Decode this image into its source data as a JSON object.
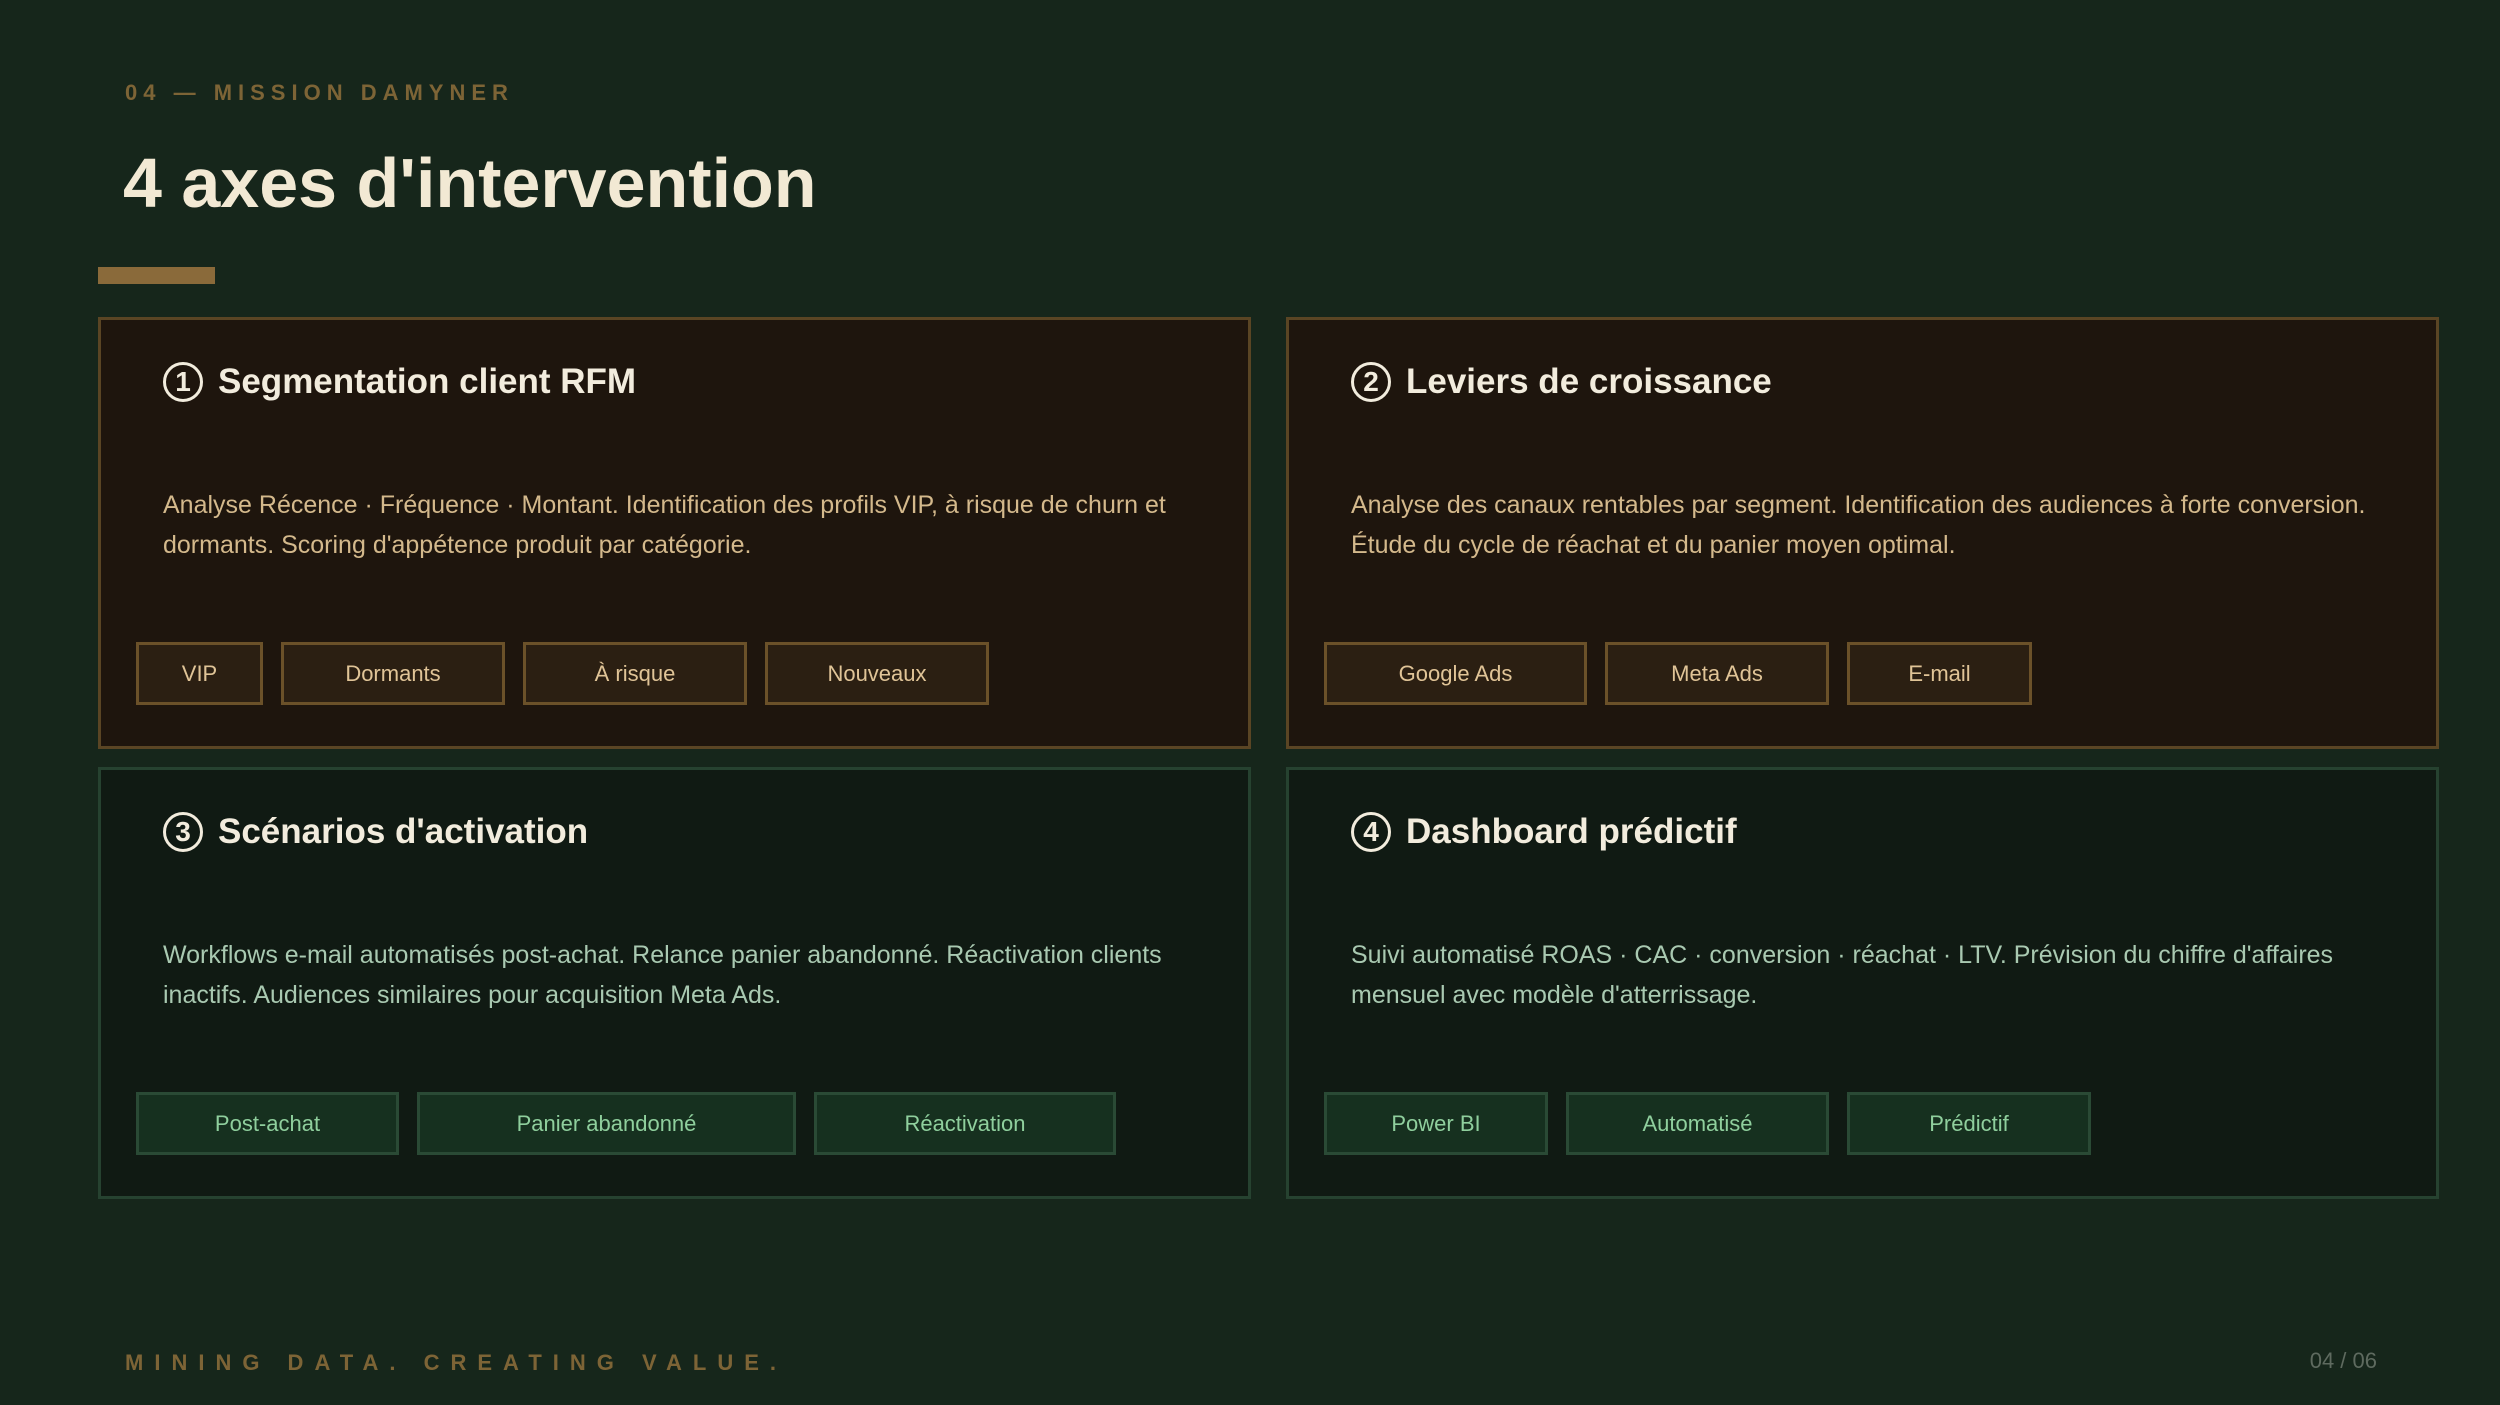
{
  "header": {
    "eyebrow": "04 — MISSION DAMYNER",
    "title": "4 axes d'intervention"
  },
  "cards": [
    {
      "number": "1",
      "title": "Segmentation client RFM",
      "description": "Analyse Récence · Fréquence · Montant. Identification des profils VIP, à risque de churn et dormants. Scoring d'appétence produit par catégorie.",
      "tags": [
        "VIP",
        "Dormants",
        "À risque",
        "Nouveaux"
      ]
    },
    {
      "number": "2",
      "title": "Leviers de croissance",
      "description": "Analyse des canaux rentables par segment. Identification des audiences à forte conversion. Étude du cycle de réachat et du panier moyen optimal.",
      "tags": [
        "Google Ads",
        "Meta Ads",
        "E-mail"
      ]
    },
    {
      "number": "3",
      "title": "Scénarios d'activation",
      "description": "Workflows e-mail automatisés post-achat. Relance panier abandonné. Réactivation clients inactifs. Audiences similaires pour acquisition Meta Ads.",
      "tags": [
        "Post-achat",
        "Panier abandonné",
        "Réactivation"
      ]
    },
    {
      "number": "4",
      "title": "Dashboard prédictif",
      "description": "Suivi automatisé ROAS · CAC · conversion · réachat · LTV. Prévision du chiffre d'affaires mensuel avec modèle d'atterrissage.",
      "tags": [
        "Power BI",
        "Automatisé",
        "Prédictif"
      ]
    }
  ],
  "footer": {
    "tagline": "MINING DATA. CREATING VALUE.",
    "page": "04 / 06"
  },
  "colors": {
    "background": "#16261b",
    "accent": "#8a6a3a",
    "warm_card": "#1e150d",
    "green_card": "#101a13"
  }
}
